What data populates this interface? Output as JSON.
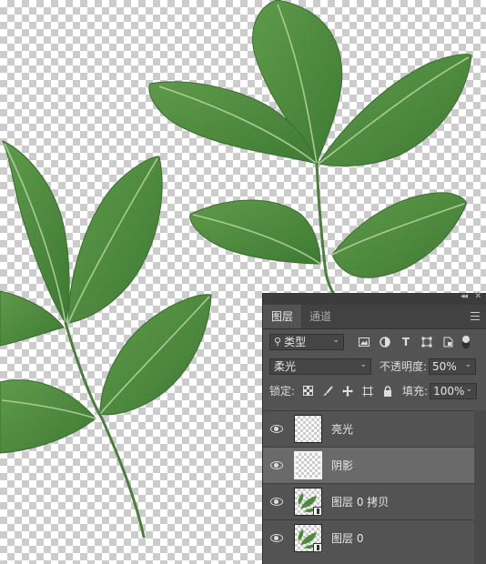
{
  "canvas": {
    "background": "transparent-checkerboard",
    "subject": "green compound leaf sprigs"
  },
  "panel": {
    "collapse_icon": "collapse-double-arrow-icon",
    "close_icon": "close-icon",
    "tabs": [
      {
        "label": "图层",
        "active": true
      },
      {
        "label": "通道",
        "active": false
      }
    ],
    "menu_icon": "panel-menu-icon",
    "filter": {
      "kind_label": "类型",
      "icons": [
        "image-filter-icon",
        "adjustment-filter-icon",
        "type-filter-icon",
        "shape-filter-icon",
        "smart-object-filter-icon"
      ],
      "type_glyph": "T"
    },
    "blend_mode": "柔光",
    "opacity_label": "不透明度:",
    "opacity_value": "50%",
    "lock_label": "锁定:",
    "fill_label": "填充:",
    "fill_value": "100%",
    "layers": [
      {
        "name": "亮光",
        "visible": true,
        "selected": false,
        "thumb": "transparent"
      },
      {
        "name": "阴影",
        "visible": true,
        "selected": true,
        "thumb": "transparent"
      },
      {
        "name": "图层 0 拷贝",
        "visible": true,
        "selected": false,
        "thumb": "leaf-smart-object"
      },
      {
        "name": "图层 0",
        "visible": true,
        "selected": false,
        "thumb": "leaf-smart-object"
      }
    ]
  },
  "colors": {
    "panel_bg": "#535353",
    "selected_layer": "#6a6a6a",
    "leaf": "#4e8a3e"
  }
}
